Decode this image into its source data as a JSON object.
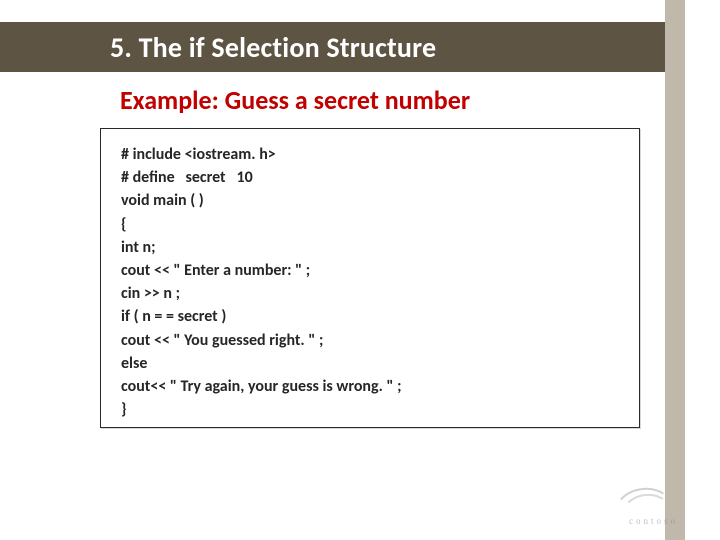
{
  "title_bar": {
    "text": "5.  The if Selection Structure"
  },
  "subtitle": "Example: Guess a secret number",
  "code_lines": [
    "# include <iostream. h>",
    "# define   secret   10",
    "void main ( )",
    "{",
    "int n;",
    "cout << \" Enter a number: \" ;",
    "cin >> n ;",
    "if ( n = = secret )",
    "cout << \" You guessed right. \" ;",
    "else",
    "cout<< \" Try again, your guess is wrong. \" ;",
    "}"
  ],
  "logo": {
    "text": "contoso"
  }
}
